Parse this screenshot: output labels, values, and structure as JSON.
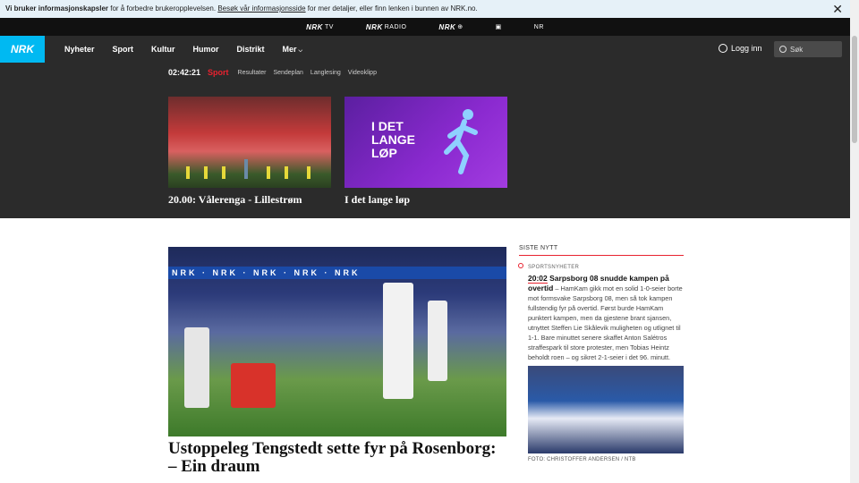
{
  "cookie": {
    "bold": "Vi bruker informasjonskapsler",
    "text1": " for å forbedre brukeropplevelsen. ",
    "link": "Besøk vår informasjonsside",
    "text2": " for mer detaljer, eller finn lenken i bunnen av NRK.no.",
    "close": "✕"
  },
  "brands": [
    {
      "nrk": "NRK",
      "label": "TV"
    },
    {
      "nrk": "NRK",
      "label": "RADIO"
    },
    {
      "nrk": "NRK",
      "label": "⊕"
    },
    {
      "nrk": "",
      "label": "▣"
    },
    {
      "nrk": "",
      "label": "NR"
    }
  ],
  "nav": {
    "logo": "NRK",
    "links": [
      "Nyheter",
      "Sport",
      "Kultur",
      "Humor",
      "Distrikt",
      "Mer"
    ],
    "more_chevron": "⌵",
    "login": "Logg inn",
    "search_placeholder": "Søk"
  },
  "subnav": {
    "time": "02:42:21",
    "section": "Sport",
    "links": [
      "Resultater",
      "Sendeplan",
      "Langlesing",
      "Videoklipp"
    ]
  },
  "hero_cards": [
    {
      "caption": "20.00: Vålerenga - Lillestrøm"
    },
    {
      "caption": "I det lange løp",
      "image_text": [
        "I DET",
        "LANGE",
        "LØP"
      ]
    }
  ],
  "main_article": {
    "boards_text": "NRK  ·  NRK  ·  NRK  ·  NRK  ·  NRK",
    "title": "Ustoppeleg Tengstedt sette fyr på Rosenborg: – Ein draum"
  },
  "sidebar": {
    "heading": "SISTE NYTT",
    "category": "SPORTSNYHETER",
    "time": "20:02",
    "headline": "Sarpsborg 08 snudde kampen på overtid",
    "body": " – HamKam gikk mot en solid 1-0-seier borte mot formsvake Sarpsborg 08, men så tok kampen fullstendig fyr på overtid. Først burde HamKam punktert kampen, men da gjestene brant sjansen, utnyttet Steffen Lie Skålevik muligheten og utlignet til 1-1. Bare minuttet senere skaffet Anton Salétros straffespark til store protester, men Tobias Heintz beholdt roen – og sikret 2-1-seier i det 96. minutt.",
    "credit": "FOTO: CHRISTOFFER ANDERSEN / NTB"
  }
}
